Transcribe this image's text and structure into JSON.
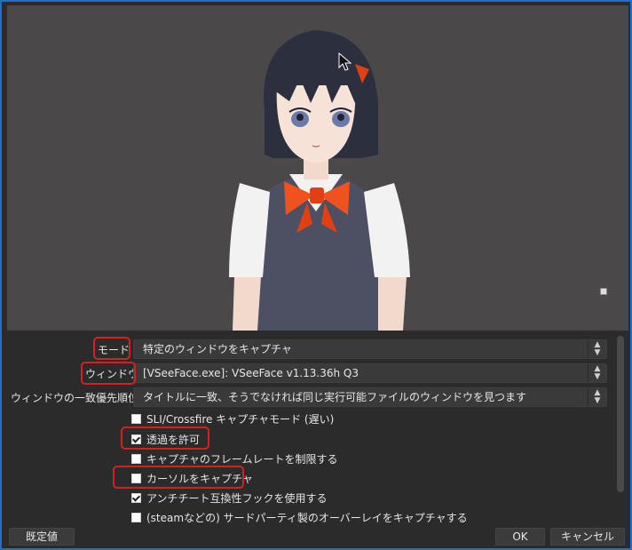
{
  "settings": {
    "mode": {
      "label": "モード",
      "value": "特定のウィンドウをキャプチャ"
    },
    "window": {
      "label": "ウィンドウ",
      "value": "[VSeeFace.exe]: VSeeFace v1.13.36h Q3"
    },
    "priority": {
      "label": "ウィンドウの一致優先順位",
      "value": "タイトルに一致、そうでなければ同じ実行可能ファイルのウィンドウを見つます"
    },
    "checkboxes": [
      {
        "label": "SLI/Crossfire キャプチャモード (遅い)",
        "checked": false
      },
      {
        "label": "透過を許可",
        "checked": true
      },
      {
        "label": "キャプチャのフレームレートを制限する",
        "checked": false
      },
      {
        "label": "カーソルをキャプチャ",
        "checked": false
      },
      {
        "label": "アンチチート互換性フックを使用する",
        "checked": true
      },
      {
        "label": "(steamなどの) サードパーティ製のオーバーレイをキャプチャする",
        "checked": false
      }
    ]
  },
  "buttons": {
    "defaults": "既定値",
    "ok": "OK",
    "cancel": "キャンセル"
  },
  "icons": {
    "select_arrows": "updown-arrows-icon",
    "cursor": "mouse-cursor-icon",
    "preview_marker": "small-square-icon"
  },
  "colors": {
    "highlight": "#d42020",
    "window_border": "#1e6fd0",
    "preview_bg": "#4a4848"
  }
}
